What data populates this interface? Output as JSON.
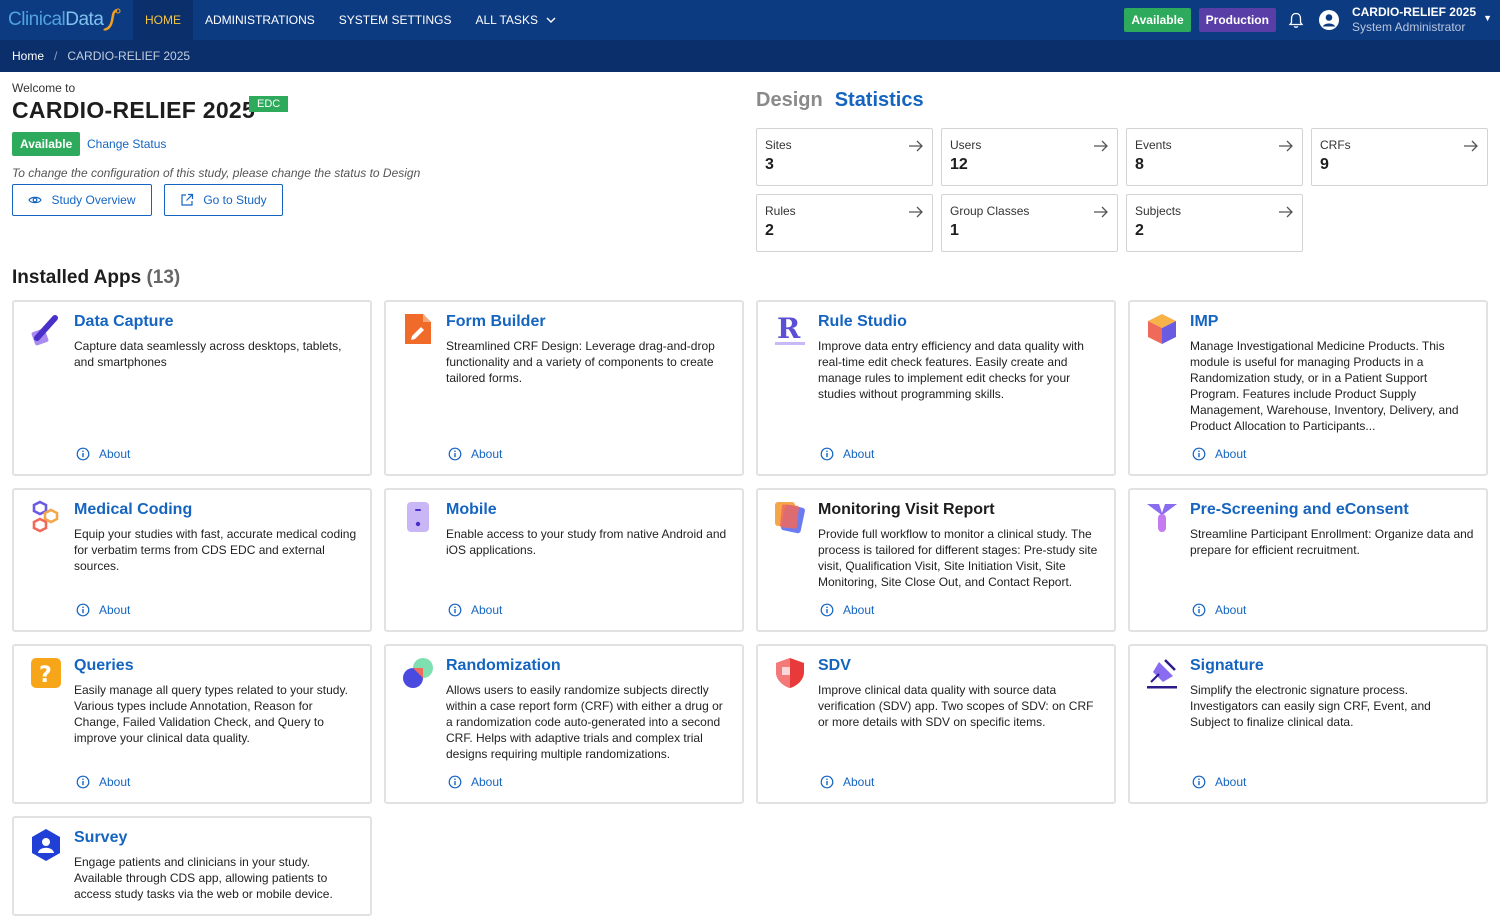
{
  "header": {
    "logo_text_1": "Clinical",
    "logo_text_2": "Data",
    "nav": [
      "HOME",
      "ADMINISTRATIONS",
      "SYSTEM SETTINGS",
      "ALL TASKS"
    ],
    "status_badge": "Available",
    "env_badge": "Production",
    "user_study": "CARDIO-RELIEF 2025",
    "user_role": "System Administrator"
  },
  "breadcrumb": {
    "home": "Home",
    "current": "CARDIO-RELIEF 2025"
  },
  "study": {
    "welcome": "Welcome to",
    "title": "CARDIO-RELIEF 2025",
    "type_badge": "EDC",
    "status": "Available",
    "change_status": "Change Status",
    "hint": "To change the configuration of this study, please change the status to Design",
    "overview_btn": "Study Overview",
    "goto_btn": "Go to Study"
  },
  "tabs": {
    "design": "Design",
    "statistics": "Statistics"
  },
  "stats": [
    {
      "label": "Sites",
      "value": "3"
    },
    {
      "label": "Users",
      "value": "12"
    },
    {
      "label": "Events",
      "value": "8"
    },
    {
      "label": "CRFs",
      "value": "9"
    },
    {
      "label": "Rules",
      "value": "2"
    },
    {
      "label": "Group Classes",
      "value": "1"
    },
    {
      "label": "Subjects",
      "value": "2"
    }
  ],
  "apps_heading": {
    "label": "Installed Apps",
    "count": "(13)"
  },
  "apps": [
    {
      "icon": "data-capture-icon",
      "title": "Data Capture",
      "desc": "Capture data seamlessly across desktops, tablets, and smartphones",
      "about": "About"
    },
    {
      "icon": "form-builder-icon",
      "title": "Form Builder",
      "desc": "Streamlined CRF Design: Leverage drag-and-drop functionality and a variety of components to create tailored forms.",
      "about": "About"
    },
    {
      "icon": "rule-studio-icon",
      "title": "Rule Studio",
      "desc": "Improve data entry efficiency and data quality with real-time edit check features. Easily create and manage rules to implement edit checks for your studies without programming skills.",
      "about": "About"
    },
    {
      "icon": "imp-icon",
      "title": "IMP",
      "desc": "Manage Investigational Medicine Products. This module is useful for managing Products in a Randomization study, or in a Patient Support Program. Features include Product Supply Management, Warehouse, Inventory, Delivery, and Product Allocation to Participants...",
      "about": "About"
    },
    {
      "icon": "medical-coding-icon",
      "title": "Medical Coding",
      "desc": "Equip your studies with fast, accurate medical coding for verbatim terms from CDS EDC and external sources.",
      "about": "About"
    },
    {
      "icon": "mobile-icon",
      "title": "Mobile",
      "desc": "Enable access to your study from native Android and iOS applications.",
      "about": "About"
    },
    {
      "icon": "monitoring-visit-icon",
      "title": "Monitoring Visit Report",
      "desc": "Provide full workflow to monitor a clinical study. The process is tailored for different stages: Pre-study site visit, Qualification Visit, Site Initiation Visit, Site Monitoring, Site Close Out, and Contact Report.",
      "about": "About"
    },
    {
      "icon": "pre-screening-icon",
      "title": "Pre-Screening and eConsent",
      "desc": "Streamline Participant Enrollment: Organize data and prepare for efficient recruitment.",
      "about": "About"
    },
    {
      "icon": "queries-icon",
      "title": "Queries",
      "desc": "Easily manage all query types related to your study. Various types include Annotation, Reason for Change, Failed Validation Check, and Query to improve your clinical data quality.",
      "about": "About"
    },
    {
      "icon": "randomization-icon",
      "title": "Randomization",
      "desc": "Allows users to easily randomize subjects directly within a case report form (CRF) with either a drug or a randomization code auto-generated into a second CRF. Helps with adaptive trials and complex trial designs requiring multiple randomizations.",
      "about": "About"
    },
    {
      "icon": "sdv-icon",
      "title": "SDV",
      "desc": "Improve clinical data quality with source data verification (SDV) app. Two scopes of SDV: on CRF or more details with SDV on specific items.",
      "about": "About"
    },
    {
      "icon": "signature-icon",
      "title": "Signature",
      "desc": "Simplify the electronic signature process. Investigators can easily sign CRF, Event, and Subject to finalize clinical data.",
      "about": "About"
    },
    {
      "icon": "survey-icon",
      "title": "Survey",
      "desc": "Engage patients and clinicians in your study. Available through CDS app, allowing patients to access study tasks via the web or mobile device.",
      "about": "About"
    }
  ],
  "colors": {
    "nav_bg": "#0d3b82",
    "breadcrumb_bg": "#0a2f6b",
    "accent": "#1565c0",
    "available": "#2eaa5c",
    "production": "#5a3ea8",
    "nav_active": "#f6c445"
  }
}
